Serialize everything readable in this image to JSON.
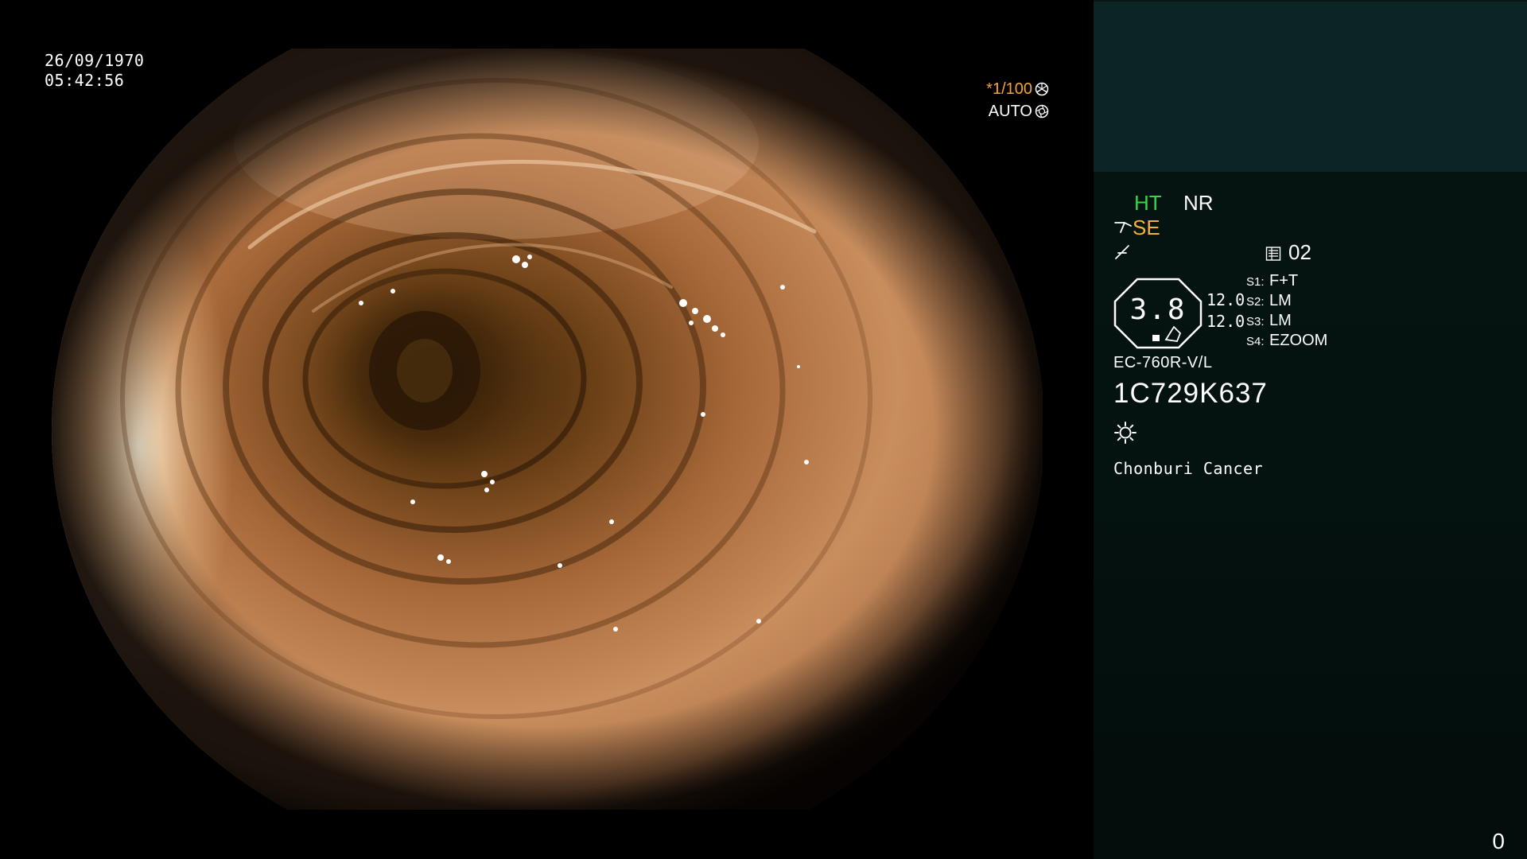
{
  "viewport": {
    "date": "26/09/1970",
    "time": "05:42:56",
    "shutter": "*1/100",
    "iris": "AUTO",
    "icons": [
      "shutter-icon",
      "iris-icon"
    ]
  },
  "panel": {
    "ht_label": "HT",
    "nr_label": "NR",
    "se_label": "SE",
    "memory_number": "02",
    "zoom_value": "3.8",
    "scale_top": "12.0",
    "scale_bottom": "12.0",
    "switches": [
      {
        "key": "S1:",
        "value": "F+T"
      },
      {
        "key": "S2:",
        "value": "LM"
      },
      {
        "key": "S3:",
        "value": "LM"
      },
      {
        "key": "S4:",
        "value": "EZOOM"
      }
    ],
    "scope_model": "EC-760R-V/L",
    "scope_serial": "1C729K637",
    "institution": "Chonburi Cancer",
    "frame_counter": "0",
    "icons": [
      "hook-icon",
      "freeze-icon",
      "memo-icon",
      "light-icon"
    ],
    "colors": {
      "ht": "#3ed24a",
      "se": "#f2b23a",
      "shutter": "#f2a43a",
      "panel_top": "#0c2424"
    }
  }
}
